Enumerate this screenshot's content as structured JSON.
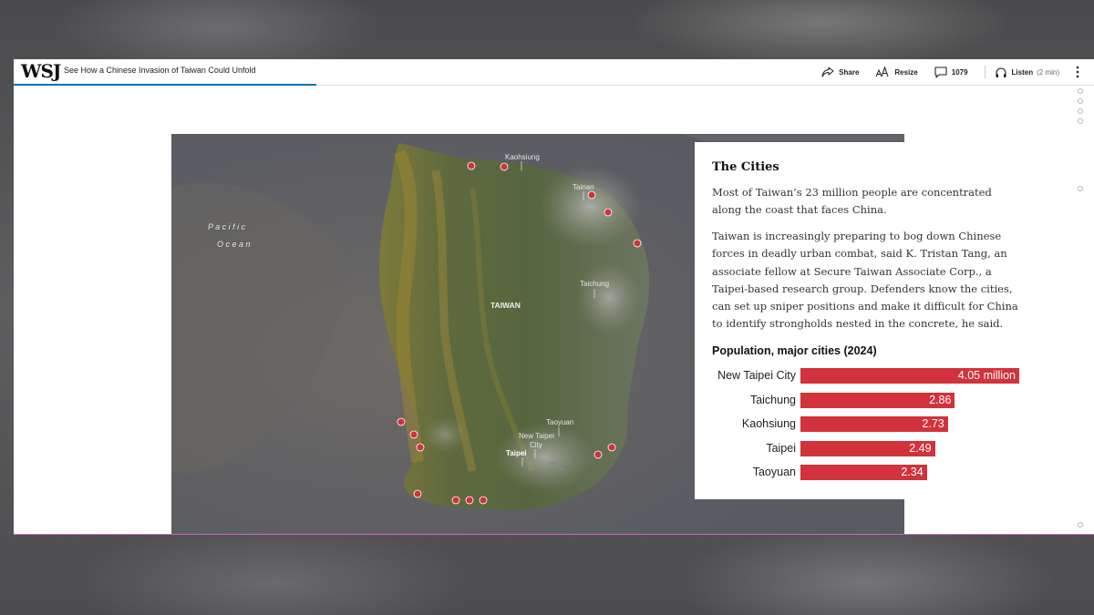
{
  "header": {
    "logo": "WSJ",
    "article_title": "See How a Chinese Invasion of Taiwan Could Unfold",
    "share_label": "Share",
    "resize_label": "Resize",
    "comments_count": "1079",
    "listen_label": "Listen",
    "listen_duration": "(2 min)",
    "reading_progress_percent": 28
  },
  "map": {
    "ocean_label_line1": "P a c i f i c",
    "ocean_label_line2": "O c e a n",
    "island_label": "TAIWAN",
    "cities": {
      "kaohsiung": "Kaohsiung",
      "tainan": "Tainan",
      "taichung": "Taichung",
      "taoyuan": "Taoyuan",
      "new_taipei_line1": "New Taipei",
      "new_taipei_line2": "City",
      "taipei": "Taipei"
    },
    "colors": {
      "background": "#5e6065",
      "land": "#5d6a47",
      "urban": "#9a9c98",
      "landing_marker": "#d1323c"
    }
  },
  "panel": {
    "heading": "The Cities",
    "paragraph1": "Most of Taiwan’s 23 million people are concentrated along the coast that faces China.",
    "paragraph2": "Taiwan is increasingly preparing to bog down Chinese forces in deadly urban combat, said K. Tristan Tang, an associate fellow at Secure Taiwan Associate Corp., a Taipei-based research group. Defenders know the cities, can set up sniper positions and make it difficult for China to identify strongholds nested in the concrete, he said."
  },
  "chart_data": {
    "type": "bar",
    "title": "Population, major cities (2024)",
    "categories": [
      "New Taipei City",
      "Taichung",
      "Kaohsiung",
      "Taipei",
      "Taoyuan"
    ],
    "values": [
      4.05,
      2.86,
      2.73,
      2.49,
      2.34
    ],
    "value_labels": [
      "4.05 million",
      "2.86",
      "2.73",
      "2.49",
      "2.34"
    ],
    "xlim": [
      0,
      4.05
    ],
    "orientation": "horizontal",
    "bar_color": "#d1323c",
    "grid": false
  }
}
